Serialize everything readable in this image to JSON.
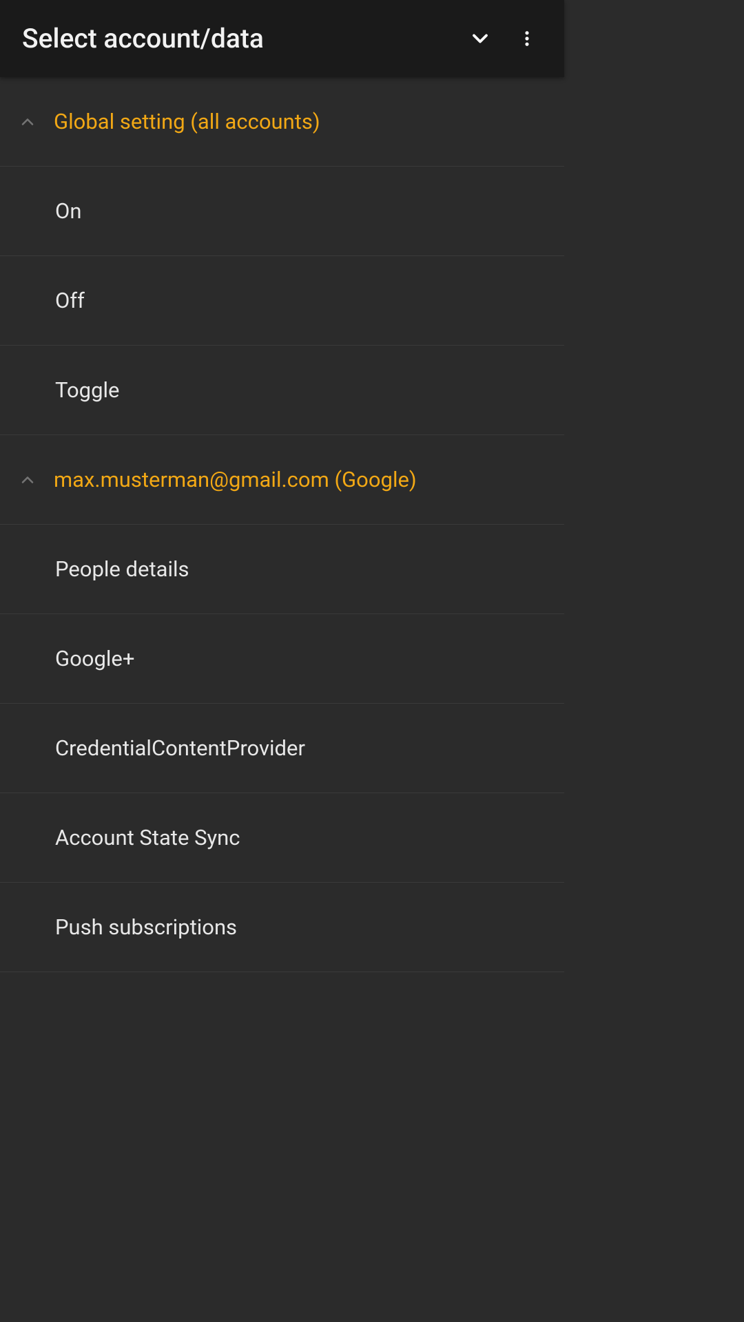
{
  "header": {
    "title": "Select account/data"
  },
  "colors": {
    "accent": "#f2a815",
    "background": "#2b2b2b",
    "headerBg": "#1a1a1a",
    "text": "#e8e8e8",
    "divider": "#3a3a3a"
  },
  "sections": [
    {
      "title": "Global setting (all accounts)",
      "expanded": true,
      "items": [
        {
          "label": "On"
        },
        {
          "label": "Off"
        },
        {
          "label": "Toggle"
        }
      ]
    },
    {
      "title": "max.musterman@gmail.com (Google)",
      "expanded": true,
      "items": [
        {
          "label": "People details"
        },
        {
          "label": "Google+"
        },
        {
          "label": "CredentialContentProvider"
        },
        {
          "label": "Account State Sync"
        },
        {
          "label": "Push subscriptions"
        }
      ]
    }
  ]
}
